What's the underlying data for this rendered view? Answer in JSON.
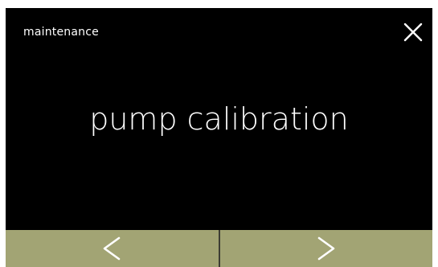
{
  "header": {
    "title": "maintenance"
  },
  "main": {
    "label": "pump calibration"
  },
  "icons": {
    "close": "close-icon",
    "previous": "chevron-left-icon",
    "next": "chevron-right-icon"
  },
  "colors": {
    "screen_background": "#000000",
    "text": "#ffffff",
    "nav_bar": "#a2a474",
    "nav_divider": "#3d3d33"
  }
}
